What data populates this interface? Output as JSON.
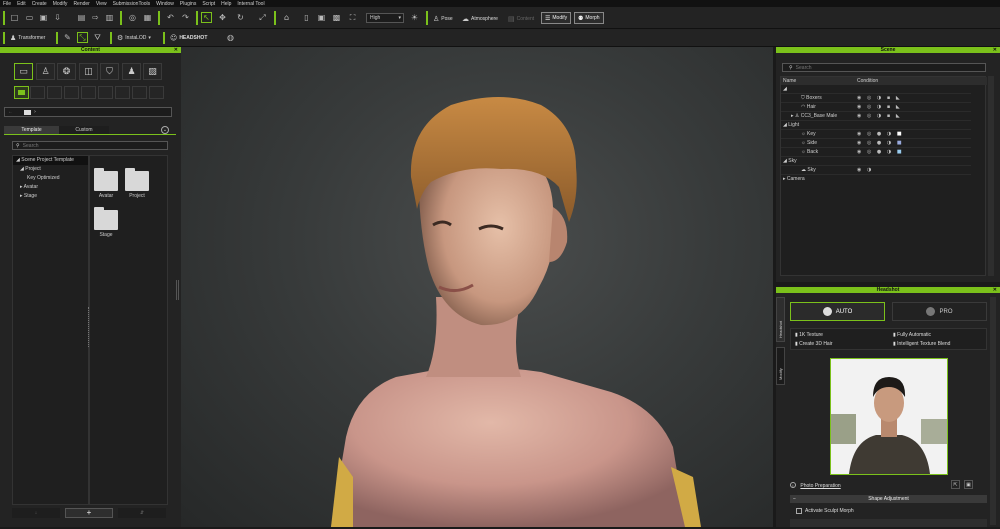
{
  "menu": [
    "File",
    "Edit",
    "Create",
    "Modify",
    "Render",
    "View",
    "SubmissionTools",
    "Window",
    "Plugins",
    "Script",
    "Help",
    "Internal Tool"
  ],
  "toolbar": {
    "quality": "High",
    "pose": "Pose",
    "atmosphere": "Atmosphere",
    "content": "Content",
    "modify": "Modify",
    "morph": "Morph"
  },
  "toolbar2": {
    "transformer": "Transformer",
    "instalod": "InstaLOD",
    "headshot": "HEADSHOT"
  },
  "content": {
    "title": "Content",
    "tabs": [
      "Template",
      "Custom"
    ],
    "search_placeholder": "Search",
    "tree": [
      "Scene Project Template",
      "Project",
      "Key Optimized",
      "Avatar",
      "Stage"
    ],
    "folders": [
      "Avatar",
      "Project",
      "Stage"
    ],
    "add": "+"
  },
  "scene": {
    "title": "Scene",
    "search_placeholder": "Search",
    "col_name": "Name",
    "col_condition": "Condition",
    "rows": [
      "Boxers",
      "Hair",
      "CC3_Base Male",
      "Light",
      "Key",
      "Side",
      "Back",
      "Sky",
      "Sky",
      "Camera"
    ]
  },
  "headshot": {
    "title": "Headshot",
    "side_tabs": [
      "Headshot",
      "Modify"
    ],
    "auto": "AUTO",
    "pro": "PRO",
    "options": [
      "1K Texture",
      "Fully Automatic",
      "Create 3D Hair",
      "Intelligent Texture Blend"
    ],
    "photo_prep": "Photo Preparation",
    "shape_adjustment": "Shape Adjustment",
    "activate_sculpt": "Activate Sculpt Morph"
  },
  "colors": {
    "accent": "#7bc11b",
    "panel": "#232323",
    "viewport": "#3a3d3d"
  }
}
